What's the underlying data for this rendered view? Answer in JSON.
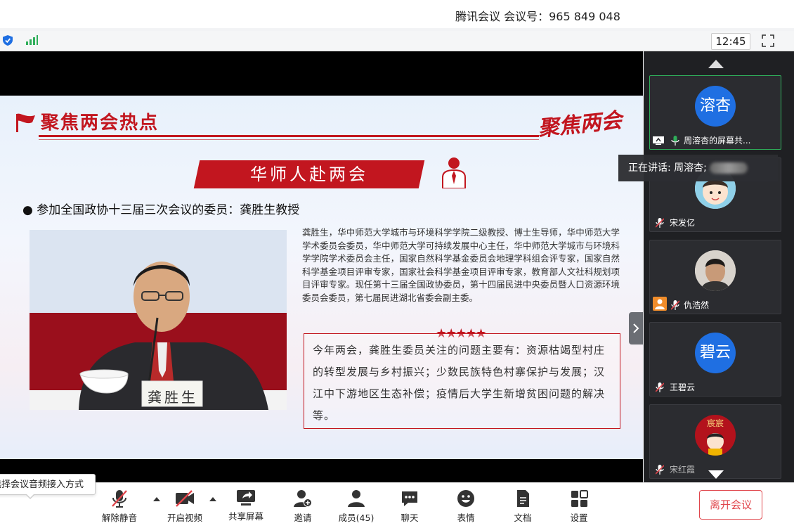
{
  "window": {
    "title": "腾讯会议 会议号：965 849 048"
  },
  "status": {
    "time": "12:45"
  },
  "slide": {
    "heading": "聚焦两会热点",
    "logo": "聚焦两会",
    "ribbon": "华师人赴两会",
    "bullet": "参加全国政协十三届三次会议的委员：龚胜生教授",
    "name_plate": "龚胜生",
    "bio": "龚胜生，华中师范大学城市与环境科学学院二级教授、博士生导师，华中师范大学学术委员会委员，华中师范大学可持续发展中心主任，华中师范大学城市与环境科学学院学术委员会主任，国家自然科学基金委员会地理学科组会评专家，国家自然科学基金项目评审专家，国家社会科学基金项目评审专家，教育部人文社科规划项目评审专家。现任第十三届全国政协委员，第十四届民进中央委员暨人口资源环境委员会委员，第七届民进湖北省委会副主委。",
    "stars": "★★★★★",
    "focus": "今年两会，龚胜生委员关注的问题主要有：资源枯竭型村庄的转型发展与乡村振兴；少数民族特色村寨保护与发展；汉江中下游地区生态补偿；疫情后大学生新增贫困问题的解决等。"
  },
  "participants": [
    {
      "avatar_text": "溶杏",
      "name": "周溶杏的屏幕共...",
      "avatar_color": "#1f6fe2",
      "sharing": true,
      "mic": "active"
    },
    {
      "avatar_text": "",
      "name": "宋发亿",
      "avatar_color": "#dfe8ef",
      "sharing": false,
      "mic": "muted"
    },
    {
      "avatar_text": "",
      "name": "仇浩然",
      "avatar_color": "#cfc6bd",
      "sharing": false,
      "mic": "muted"
    },
    {
      "avatar_text": "碧云",
      "name": "王碧云",
      "avatar_color": "#1f6fe2",
      "sharing": false,
      "mic": "muted"
    },
    {
      "avatar_text": "宸宸",
      "name": "宋红霞",
      "avatar_color": "#b3121c",
      "sharing": false,
      "mic": "muted"
    }
  ],
  "speaking": "正在讲话: 周溶杏;",
  "toolbar": {
    "unmute": "解除静音",
    "video": "开启视频",
    "share": "共享屏幕",
    "invite": "邀请",
    "members": "成员(45)",
    "chat": "聊天",
    "emoji": "表情",
    "docs": "文档",
    "settings": "设置",
    "leave": "离开会议"
  },
  "audio_tip": "选择会议音频接入方式",
  "colors": {
    "accent_red": "#c2161f",
    "leave_red": "#e0454b",
    "active_green": "#2fae5a",
    "avatar_blue": "#1f6fe2"
  }
}
